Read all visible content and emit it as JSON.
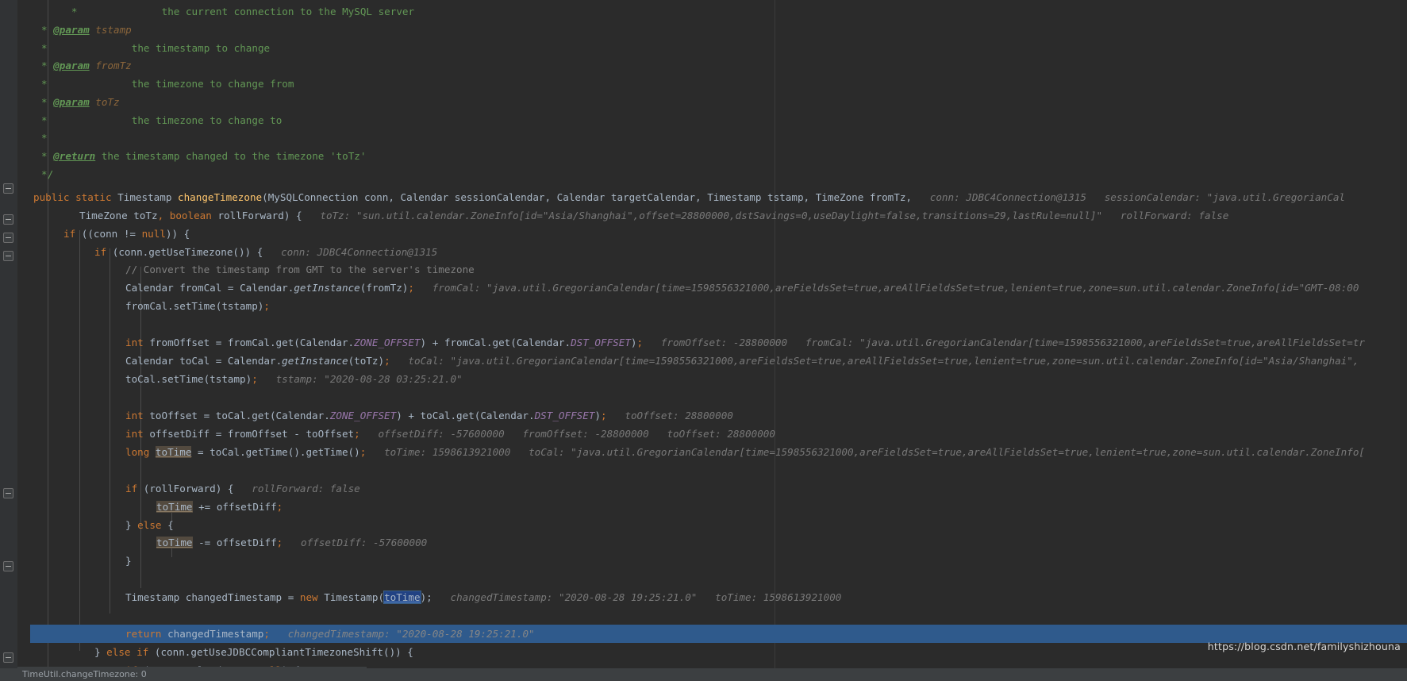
{
  "editor": {
    "language": "java",
    "theme": "darcula",
    "background_color": "#2b2b2b",
    "gutter_color": "#313335",
    "current_line_highlight_color": "#2f5a8c",
    "selection_color": "#214283",
    "watermark": "https://blog.csdn.net/familyshizhouna",
    "status_text": "TimeUtil.changeTimezone: 0"
  },
  "lines": [
    {
      "id": "doc-conn-desc",
      "indent": "     *              ",
      "text": "the current connection to the MySQL server"
    },
    {
      "id": "doc-param-tstamp",
      "tag": "@param",
      "param": "tstamp"
    },
    {
      "id": "doc-tstamp-desc",
      "text": "the timestamp to change"
    },
    {
      "id": "doc-param-fromtz",
      "tag": "@param",
      "param": "fromTz"
    },
    {
      "id": "doc-fromtz-desc",
      "text": "the timezone to change from"
    },
    {
      "id": "doc-param-totz",
      "tag": "@param",
      "param": "toTz"
    },
    {
      "id": "doc-totz-desc",
      "text": "the timezone to change to"
    },
    {
      "id": "doc-blank",
      "text": ""
    },
    {
      "id": "doc-return",
      "tag": "@return",
      "text": "the timestamp changed to the timezone 'toTz'"
    },
    {
      "id": "doc-close",
      "text": "*/"
    }
  ],
  "code": {
    "signature_line1": {
      "modifiers": "public static ",
      "return_type": "Timestamp ",
      "method_name": "changeTimezone",
      "params": "(MySQLConnection conn, Calendar sessionCalendar, Calendar targetCalendar, Timestamp tstamp, TimeZone fromTz,",
      "hint_conn_label": "conn:",
      "hint_conn_value": "JDBC4Connection@1315",
      "hint_session_label": "sessionCalendar:",
      "hint_session_value": "\"java.util.GregorianCal"
    },
    "signature_line2": {
      "text": "TimeZone toTz, boolean rollForward) {",
      "hint_totz_label": "toTz:",
      "hint_totz_value": "\"sun.util.calendar.ZoneInfo[id=\"Asia/Shanghai\",offset=28800000,dstSavings=0,useDaylight=false,transitions=29,lastRule=null]\"",
      "hint_rollforward_label": "rollForward:",
      "hint_rollforward_value": "false"
    },
    "if_conn_null": "if ((conn != null)) {",
    "if_use_timezone": {
      "text": "if (conn.getUseTimezone()) {",
      "hint_label": "conn:",
      "hint_value": "JDBC4Connection@1315"
    },
    "comment_convert": "// Convert the timestamp from GMT to the server's timezone",
    "from_cal": {
      "text": "Calendar fromCal = Calendar.getInstance(fromTz);",
      "hint_label": "fromCal:",
      "hint_value": "\"java.util.GregorianCalendar[time=1598556321000,areFieldsSet=true,areAllFieldsSet=true,lenient=true,zone=sun.util.calendar.ZoneInfo[id=\"GMT-08:00"
    },
    "from_cal_settime": "fromCal.setTime(tstamp);",
    "from_offset": {
      "text": "int fromOffset = fromCal.get(Calendar.ZONE_OFFSET) + fromCal.get(Calendar.DST_OFFSET);",
      "hint1_label": "fromOffset:",
      "hint1_value": "-28800000",
      "hint2_label": "fromCal:",
      "hint2_value": "\"java.util.GregorianCalendar[time=1598556321000,areFieldsSet=true,areAllFieldsSet=tr"
    },
    "to_cal": {
      "text": "Calendar toCal = Calendar.getInstance(toTz);",
      "hint_label": "toCal:",
      "hint_value": "\"java.util.GregorianCalendar[time=1598556321000,areFieldsSet=true,areAllFieldsSet=true,lenient=true,zone=sun.util.calendar.ZoneInfo[id=\"Asia/Shanghai\","
    },
    "to_cal_settime": {
      "text": "toCal.setTime(tstamp);",
      "hint_label": "tstamp:",
      "hint_value": "\"2020-08-28 03:25:21.0\""
    },
    "to_offset": {
      "text": "int toOffset = toCal.get(Calendar.ZONE_OFFSET) + toCal.get(Calendar.DST_OFFSET);",
      "hint_label": "toOffset:",
      "hint_value": "28800000"
    },
    "offset_diff": {
      "text": "int offsetDiff = fromOffset - toOffset;",
      "hint1_label": "offsetDiff:",
      "hint1_value": "-57600000",
      "hint2_label": "fromOffset:",
      "hint2_value": "-28800000",
      "hint3_label": "toOffset:",
      "hint3_value": "28800000"
    },
    "to_time": {
      "prefix": "long ",
      "var": "toTime",
      "text": " = toCal.getTime().getTime();",
      "hint1_label": "toTime:",
      "hint1_value": "1598613921000",
      "hint2_label": "toCal:",
      "hint2_value": "\"java.util.GregorianCalendar[time=1598556321000,areFieldsSet=true,areAllFieldsSet=true,lenient=true,zone=sun.util.calendar.ZoneInfo["
    },
    "if_rollforward": {
      "text": "if (rollForward) {",
      "hint_label": "rollForward:",
      "hint_value": "false"
    },
    "to_time_plus": {
      "var": "toTime",
      "text": " += offsetDiff;"
    },
    "else_open": "} else {",
    "to_time_minus": {
      "var": "toTime",
      "text": " -= offsetDiff;",
      "hint_label": "offsetDiff:",
      "hint_value": "-57600000"
    },
    "close_brace": "}",
    "changed_timestamp": {
      "prefix": "Timestamp changedTimestamp = ",
      "kw_new": "new ",
      "ctor": "Timestamp(",
      "selected_var": "toTime",
      "suffix": ");",
      "hint1_label": "changedTimestamp:",
      "hint1_value": "\"2020-08-28 19:25:21.0\"",
      "hint2_label": "toTime:",
      "hint2_value": "1598613921000"
    },
    "return_line": {
      "kw": "return ",
      "text": "changedTimestamp;",
      "hint_label": "changedTimestamp:",
      "hint_value": "\"2020-08-28 19:25:21.0\""
    },
    "else_if_jdbc": "} else if (conn.getUseJDBCCompliantTimezoneShift()) {",
    "if_target_calendar": "if (targetCalendar != null) {"
  }
}
